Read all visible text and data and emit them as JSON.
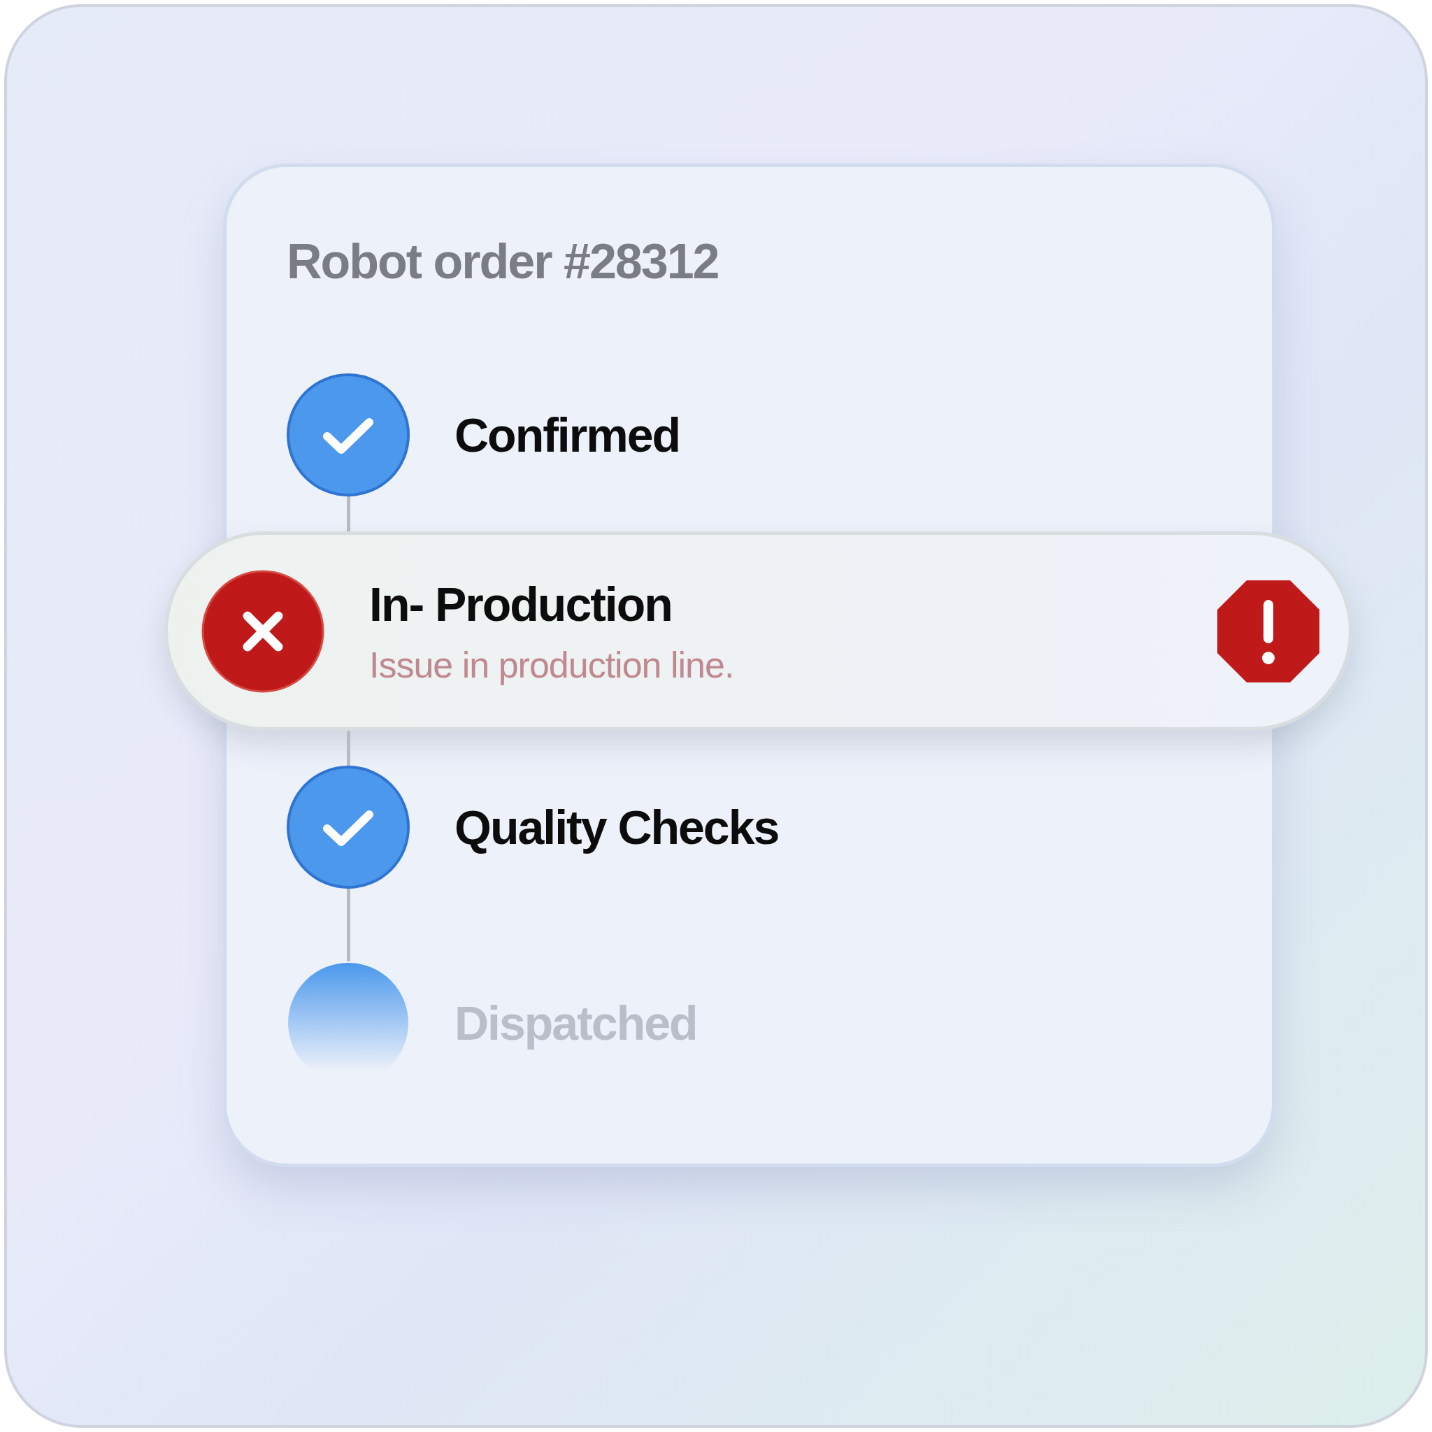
{
  "card": {
    "title": "Robot order #28312"
  },
  "steps": [
    {
      "kind": "done",
      "label": "Confirmed"
    },
    {
      "kind": "error",
      "label": "In- Production",
      "note": "Issue in production line."
    },
    {
      "kind": "done",
      "label": "Quality Checks"
    },
    {
      "kind": "pending",
      "label": "Dispatched"
    }
  ]
}
